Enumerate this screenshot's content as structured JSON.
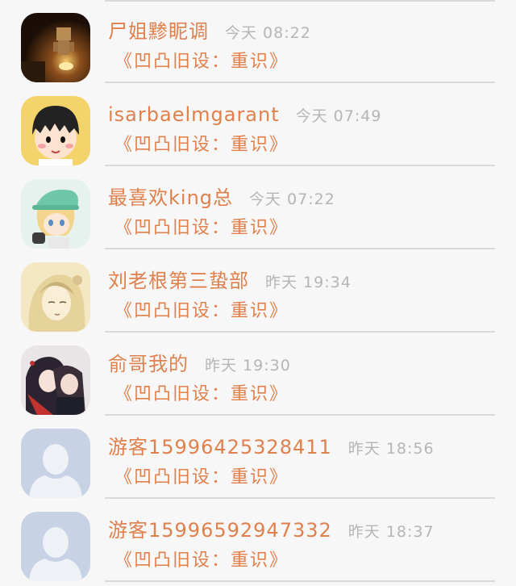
{
  "items": [
    {
      "name": "尸姐黪眤调",
      "time": "今天 08:22",
      "preview": "《凹凸旧设：重识》",
      "avatar": "avatar-candle-figure"
    },
    {
      "name": "isarbaelmgarant",
      "time": "今天 07:49",
      "preview": "《凹凸旧设：重识》",
      "avatar": "avatar-cartoon-girl"
    },
    {
      "name": "最喜欢king总",
      "time": "今天 07:22",
      "preview": "《凹凸旧设：重识》",
      "avatar": "avatar-anime-cap-boy"
    },
    {
      "name": "刘老根第三蛰部",
      "time": "昨天 19:34",
      "preview": "《凹凸旧设：重识》",
      "avatar": "avatar-sketch-girl"
    },
    {
      "name": "俞哥我的",
      "time": "昨天 19:30",
      "preview": "《凹凸旧设：重识》",
      "avatar": "avatar-anime-couple"
    },
    {
      "name": "游客15996425328411",
      "time": "昨天 18:56",
      "preview": "《凹凸旧设：重识》",
      "avatar": "avatar-default-person"
    },
    {
      "name": "游客15996592947332",
      "time": "昨天 18:37",
      "preview": "《凹凸旧设：重识》",
      "avatar": "avatar-default-person"
    }
  ],
  "colors": {
    "name": "#e0804c",
    "preview": "#e0804c",
    "time": "#b5b5b5",
    "divider": "#d9d9d9",
    "background": "#f7f7f7"
  }
}
